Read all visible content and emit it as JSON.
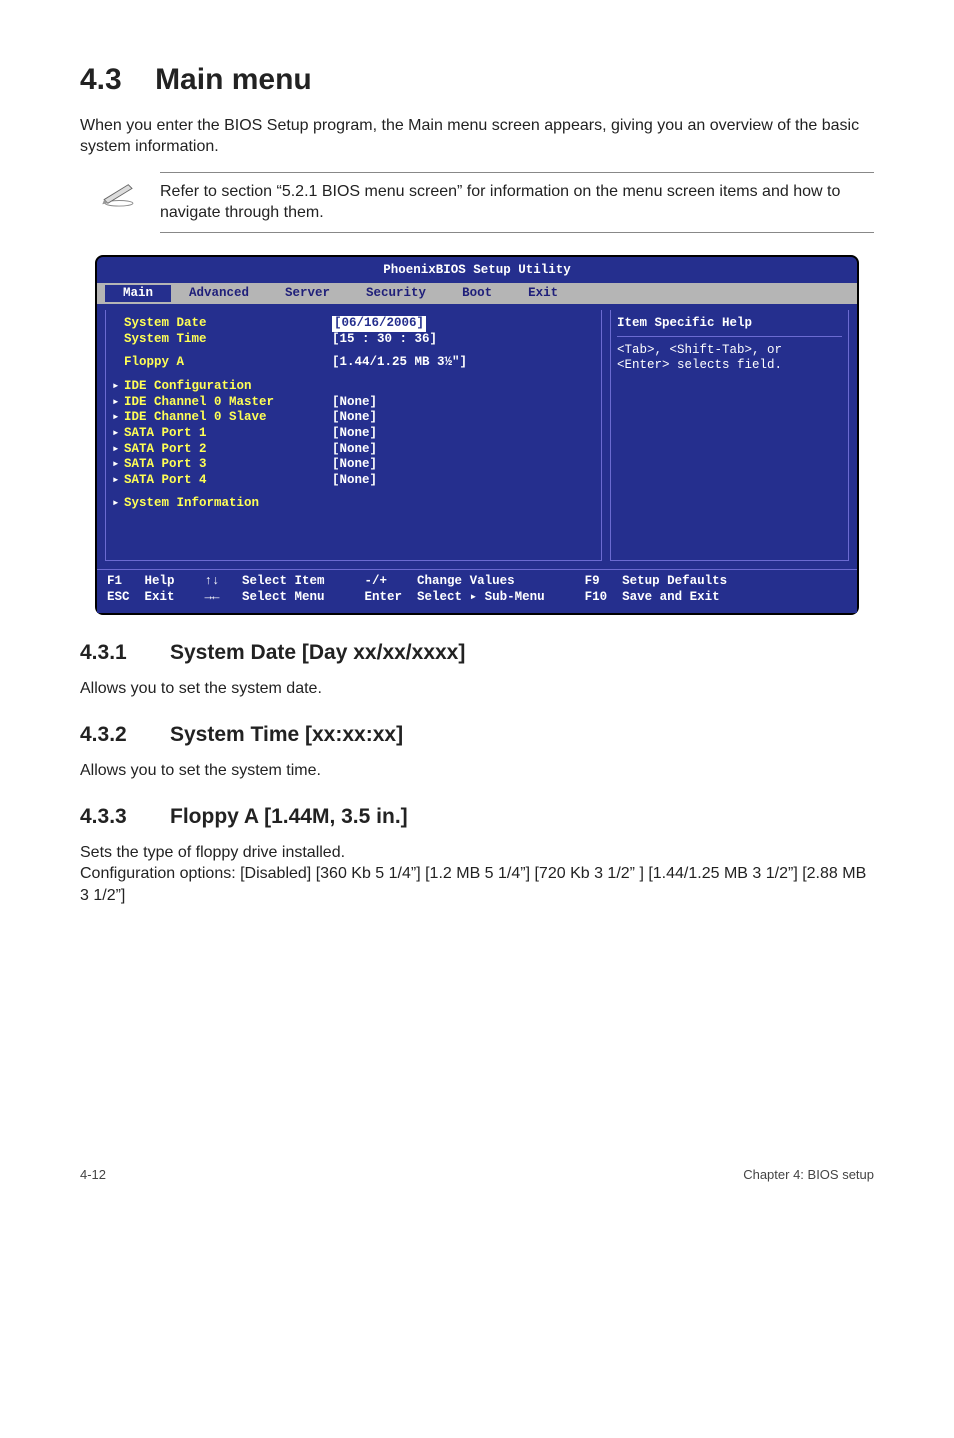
{
  "section": {
    "heading_num": "4.3",
    "heading_title": "Main menu",
    "intro": "When you enter the BIOS Setup program, the Main menu screen appears, giving you an overview of the basic system information.",
    "note": "Refer to section “5.2.1 BIOS menu screen” for information on the menu screen items and how to navigate through them."
  },
  "bios": {
    "title": "PhoenixBIOS Setup Utility",
    "menu": [
      "Main",
      "Advanced",
      "Server",
      "Security",
      "Boot",
      "Exit"
    ],
    "menu_selected": 0,
    "items": [
      {
        "label": "System Date",
        "value": "[06/16/2006]",
        "tri": false,
        "sel": true
      },
      {
        "label": "System Time",
        "value": "[15 : 30 : 36]",
        "tri": false
      },
      {
        "spacer": true
      },
      {
        "label": "Floppy A",
        "value": "[1.44/1.25 MB 3½″]",
        "tri": false
      },
      {
        "spacer": true
      },
      {
        "label": "IDE Configuration",
        "value": "",
        "tri": true
      },
      {
        "label": "IDE Channel 0 Master",
        "value": "[None]",
        "tri": true
      },
      {
        "label": "IDE Channel 0 Slave",
        "value": "[None]",
        "tri": true
      },
      {
        "label": "SATA Port 1",
        "value": "[None]",
        "tri": true
      },
      {
        "label": "SATA Port 2",
        "value": "[None]",
        "tri": true
      },
      {
        "label": "SATA Port 3",
        "value": "[None]",
        "tri": true
      },
      {
        "label": "SATA Port 4",
        "value": "[None]",
        "tri": true
      },
      {
        "spacer": true
      },
      {
        "label": "System Information",
        "value": "",
        "tri": true
      }
    ],
    "help_title": "Item Specific Help",
    "help_body": "<Tab>, <Shift-Tab>, or\n<Enter> selects field.",
    "keys": {
      "c1": "F1   Help    ↑↓   Select Item\nESC  Exit    →←   Select Menu",
      "c2": "-/+    Change Values\nEnter  Select ▸ Sub-Menu",
      "c3": "F9   Setup Defaults\nF10  Save and Exit"
    }
  },
  "subs": [
    {
      "num": "4.3.1",
      "title": "System Date [Day xx/xx/xxxx]",
      "body": "Allows you to set the system date."
    },
    {
      "num": "4.3.2",
      "title": "System Time [xx:xx:xx]",
      "body": "Allows you to set the system time."
    },
    {
      "num": "4.3.3",
      "title": "Floppy A [1.44M, 3.5 in.]",
      "body": "Sets the type of floppy drive installed.\nConfiguration options: [Disabled] [360 Kb  5 1/4”] [1.2 MB  5 1/4”] [720 Kb  3 1/2” ] [1.44/1.25 MB 3 1/2”] [2.88 MB  3 1/2”]"
    }
  ],
  "footer": {
    "left": "4-12",
    "right": "Chapter 4: BIOS setup"
  }
}
